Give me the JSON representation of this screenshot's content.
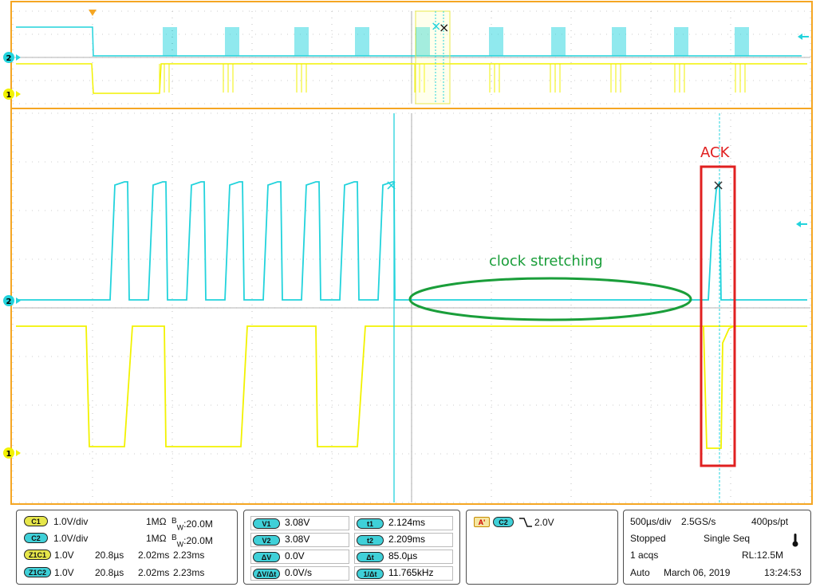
{
  "colors": {
    "frame": "#f5a623",
    "ch1": "#f2f200",
    "ch2": "#22d3dc",
    "annotation_box": "#e02020",
    "annotation_ellipse": "#1a9e3a",
    "grid": "#9a9a9a"
  },
  "markers": {
    "ch1_label": "1",
    "ch2_label": "2"
  },
  "annotations": {
    "ack": "ACK",
    "clock_stretching": "clock stretching"
  },
  "channels": [
    {
      "id": "C1",
      "scale": "1.0V/div",
      "impedance": "1MΩ",
      "bw_prefix": "B",
      "bw_sub": "W",
      "bw_value": ":20.0M"
    },
    {
      "id": "C2",
      "scale": "1.0V/div",
      "impedance": "1MΩ",
      "bw_prefix": "B",
      "bw_sub": "W",
      "bw_value": ":20.0M"
    }
  ],
  "zoom": [
    {
      "id": "Z1C1",
      "scale": "1.0V",
      "time_div": "20.8µs",
      "pos": "2.02ms",
      "end": "2.23ms"
    },
    {
      "id": "Z1C2",
      "scale": "1.0V",
      "time_div": "20.8µs",
      "pos": "2.02ms",
      "end": "2.23ms"
    }
  ],
  "cursors": {
    "v1_label": "V1",
    "v1": "3.08V",
    "v2_label": "V2",
    "v2": "3.08V",
    "dv_label": "ΔV",
    "dv": "0.0V",
    "dvdt_label": "ΔV/Δt",
    "dvdt": "0.0V/s",
    "t1_label": "t1",
    "t1": "2.124ms",
    "t2_label": "t2",
    "t2": "2.209ms",
    "dt_label": "Δt",
    "dt": "85.0µs",
    "inv_dt_label": "1/Δt",
    "inv_dt": "11.765kHz"
  },
  "trigger": {
    "mode_label": "A'",
    "source": "C2",
    "level": "2.0V",
    "slope_icon": "falling-edge-icon"
  },
  "acquisition": {
    "time_div": "500µs/div",
    "sample_rate": "2.5GS/s",
    "resolution": "400ps/pt",
    "state": "Stopped",
    "mode": "Single Seq",
    "acqs": "1 acqs",
    "record_length": "RL:12.5M",
    "trigger_mode": "Auto",
    "date": "March 06, 2019",
    "time": "13:24:53",
    "thermometer_icon": "thermometer-icon"
  }
}
